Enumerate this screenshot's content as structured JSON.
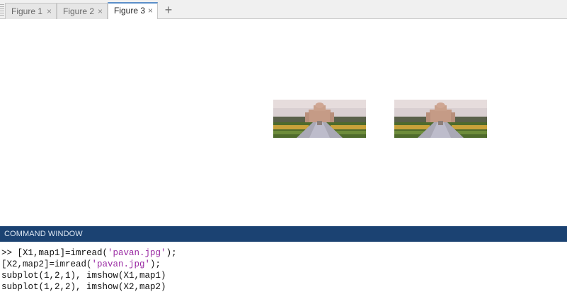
{
  "tabs": [
    {
      "label": "Figure 1",
      "active": false
    },
    {
      "label": "Figure 2",
      "active": false
    },
    {
      "label": "Figure 3",
      "active": true
    }
  ],
  "tab_close_glyph": "×",
  "tab_add_glyph": "+",
  "figure": {
    "images": [
      "temple-photo-1",
      "temple-photo-2"
    ]
  },
  "command_window": {
    "title": "COMMAND WINDOW",
    "lines": [
      {
        "prompt": ">> ",
        "pre": "[X1,map1]=imread(",
        "str": "'pavan.jpg'",
        "post": ");"
      },
      {
        "prompt": "",
        "pre": "[X2,map2]=imread(",
        "str": "'pavan.jpg'",
        "post": ");"
      },
      {
        "prompt": "",
        "pre": "subplot(1,2,1), imshow(X1,map1)",
        "str": "",
        "post": ""
      },
      {
        "prompt": "",
        "pre": "subplot(1,2,2), imshow(X2,map2)",
        "str": "",
        "post": ""
      }
    ]
  },
  "colors": {
    "header_bg": "#1b4272",
    "string_literal": "#9a2aa3",
    "active_tab_accent": "#5b8fc9"
  }
}
